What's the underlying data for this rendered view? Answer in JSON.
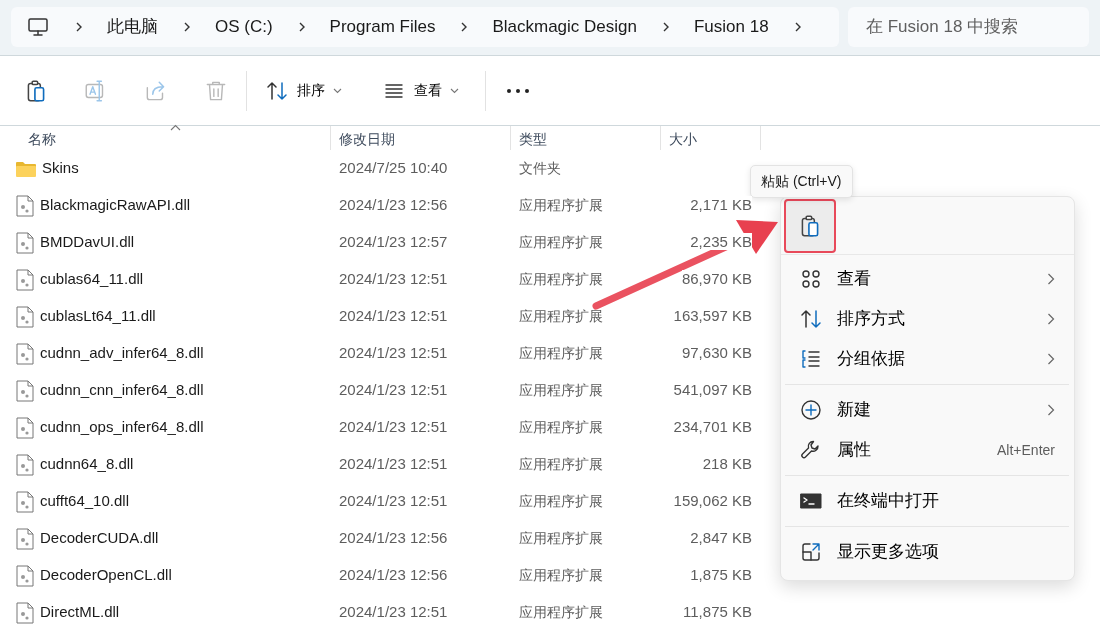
{
  "address_bar": {
    "crumbs": [
      "此电脑",
      "OS (C:)",
      "Program Files",
      "Blackmagic Design",
      "Fusion 18"
    ]
  },
  "search": {
    "placeholder": "在 Fusion 18 中搜索"
  },
  "toolbar": {
    "actions": [
      {
        "kind": "paste",
        "disabled": false
      },
      {
        "kind": "rename",
        "disabled": true
      },
      {
        "kind": "share",
        "disabled": true
      },
      {
        "kind": "delete",
        "disabled": true
      }
    ],
    "menus": [
      {
        "kind": "sort",
        "label": "排序"
      },
      {
        "kind": "view",
        "label": "查看"
      }
    ]
  },
  "table": {
    "columns": [
      {
        "label": "名称",
        "sorted": true
      },
      {
        "label": "修改日期",
        "sorted": false
      },
      {
        "label": "类型",
        "sorted": false
      },
      {
        "label": "大小",
        "sorted": false
      }
    ],
    "rows": [
      {
        "kind": "folder",
        "name": "Skins",
        "modified": "2024/7/25 10:40",
        "type": "文件夹"
      },
      {
        "kind": "file",
        "name": "BlackmagicRawAPI.dll",
        "modified": "2024/1/23 12:56",
        "type": "应用程序扩展",
        "size": "2,171 KB"
      },
      {
        "kind": "file",
        "name": "BMDDavUI.dll",
        "modified": "2024/1/23 12:57",
        "type": "应用程序扩展",
        "size": "2,235 KB"
      },
      {
        "kind": "file",
        "name": "cublas64_11.dll",
        "modified": "2024/1/23 12:51",
        "type": "应用程序扩展",
        "size": "86,970 KB"
      },
      {
        "kind": "file",
        "name": "cublasLt64_11.dll",
        "modified": "2024/1/23 12:51",
        "type": "应用程序扩展",
        "size": "163,597 KB"
      },
      {
        "kind": "file",
        "name": "cudnn_adv_infer64_8.dll",
        "modified": "2024/1/23 12:51",
        "type": "应用程序扩展",
        "size": "97,630 KB"
      },
      {
        "kind": "file",
        "name": "cudnn_cnn_infer64_8.dll",
        "modified": "2024/1/23 12:51",
        "type": "应用程序扩展",
        "size": "541,097 KB"
      },
      {
        "kind": "file",
        "name": "cudnn_ops_infer64_8.dll",
        "modified": "2024/1/23 12:51",
        "type": "应用程序扩展",
        "size": "234,701 KB"
      },
      {
        "kind": "file",
        "name": "cudnn64_8.dll",
        "modified": "2024/1/23 12:51",
        "type": "应用程序扩展",
        "size": "218 KB"
      },
      {
        "kind": "file",
        "name": "cufft64_10.dll",
        "modified": "2024/1/23 12:51",
        "type": "应用程序扩展",
        "size": "159,062 KB"
      },
      {
        "kind": "file",
        "name": "DecoderCUDA.dll",
        "modified": "2024/1/23 12:56",
        "type": "应用程序扩展",
        "size": "2,847 KB"
      },
      {
        "kind": "file",
        "name": "DecoderOpenCL.dll",
        "modified": "2024/1/23 12:56",
        "type": "应用程序扩展",
        "size": "1,875 KB"
      },
      {
        "kind": "file",
        "name": "DirectML.dll",
        "modified": "2024/1/23 12:51",
        "type": "应用程序扩展",
        "size": "11,875 KB"
      }
    ]
  },
  "context_menu": {
    "tooltip": "粘贴 (Ctrl+V)",
    "top_actions": [
      {
        "kind": "paste",
        "hovered": true,
        "highlighted": true
      }
    ],
    "groups": [
      [
        {
          "kind": "view",
          "label": "查看",
          "submenu": true
        },
        {
          "kind": "sort",
          "label": "排序方式",
          "submenu": true
        },
        {
          "kind": "group",
          "label": "分组依据",
          "submenu": true
        }
      ],
      [
        {
          "kind": "new",
          "label": "新建",
          "submenu": true
        },
        {
          "kind": "properties",
          "label": "属性",
          "submenu": false,
          "shortcut": "Alt+Enter"
        }
      ],
      [
        {
          "kind": "terminal",
          "label": "在终端中打开",
          "submenu": false
        }
      ],
      [
        {
          "kind": "more",
          "label": "显示更多选项",
          "submenu": false
        }
      ]
    ]
  },
  "annotation": {
    "arrow": true
  }
}
